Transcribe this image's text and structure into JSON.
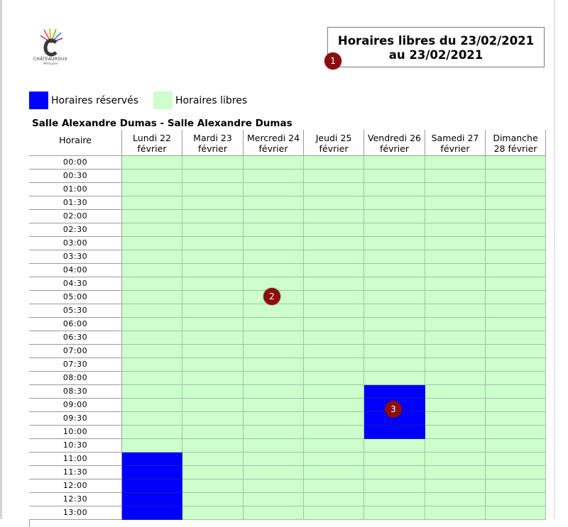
{
  "logo": {
    "name": "CHÂTEAUROUX",
    "sub": "Métropole"
  },
  "title": {
    "line1": "Horaires libres du 23/02/2021",
    "line2": "au 23/02/2021"
  },
  "legend": {
    "reserved_label": "Horaires réservés",
    "free_label": "Horaires libres",
    "reserved_color": "#0000ff",
    "free_color": "#ccffcc"
  },
  "room": {
    "title": "Salle Alexandre Dumas - Salle Alexandre Dumas"
  },
  "table": {
    "time_header": "Horaire",
    "days": [
      {
        "line1": "Lundi 22",
        "line2": "février"
      },
      {
        "line1": "Mardi 23",
        "line2": "février"
      },
      {
        "line1": "Mercredi 24",
        "line2": "février"
      },
      {
        "line1": "Jeudi 25",
        "line2": "février"
      },
      {
        "line1": "Vendredi 26",
        "line2": "février"
      },
      {
        "line1": "Samedi 27",
        "line2": "février"
      },
      {
        "line1": "Dimanche",
        "line2": "28 février"
      }
    ],
    "times": [
      "00:00",
      "00:30",
      "01:00",
      "01:30",
      "02:00",
      "02:30",
      "03:00",
      "03:30",
      "04:00",
      "04:30",
      "05:00",
      "05:30",
      "06:00",
      "06:30",
      "07:00",
      "07:30",
      "08:00",
      "08:30",
      "09:00",
      "09:30",
      "10:00",
      "10:30",
      "11:00",
      "11:30",
      "12:00",
      "12:30",
      "13:00"
    ],
    "reserved": [
      {
        "day": 4,
        "times": [
          "08:30",
          "09:00",
          "09:30",
          "10:00"
        ]
      },
      {
        "day": 0,
        "times": [
          "11:00",
          "11:30",
          "12:00",
          "12:30",
          "13:00"
        ]
      }
    ]
  },
  "markers": [
    "1",
    "2",
    "3"
  ]
}
